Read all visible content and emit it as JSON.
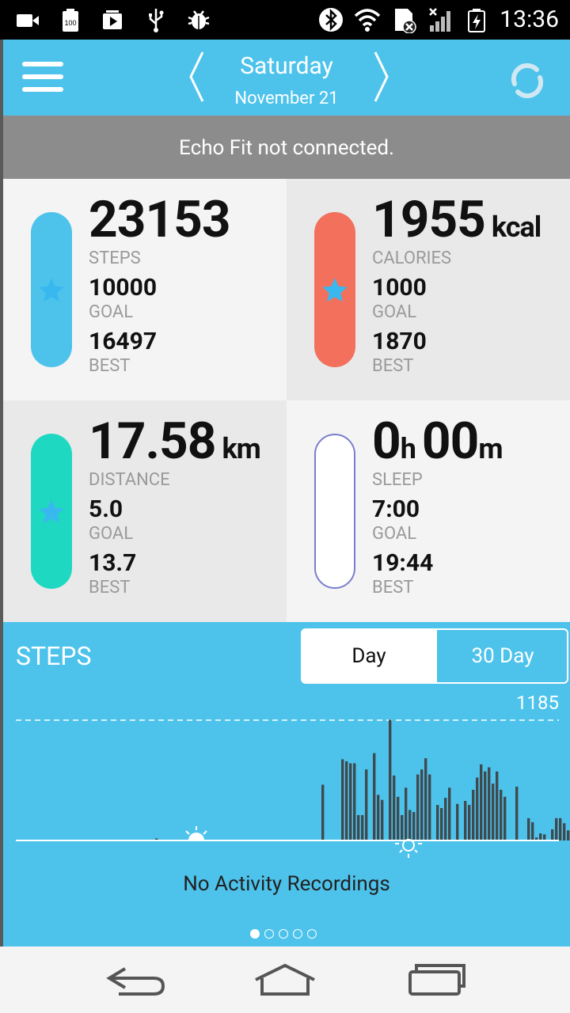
{
  "status_bar": {
    "time": "13:36",
    "battery_badge": "100",
    "left_icons": [
      "video-camera-icon",
      "battery-100-icon",
      "media-icon",
      "usb-icon",
      "bug-icon"
    ],
    "right_icons": [
      "bluetooth-icon",
      "wifi-icon",
      "sim-error-icon",
      "signal-icon",
      "battery-charging-icon"
    ]
  },
  "header": {
    "day": "Saturday",
    "date": "November 21"
  },
  "banner": {
    "text": "Echo Fit not connected."
  },
  "tiles": {
    "steps": {
      "value": "23153",
      "label": "STEPS",
      "goal": "10000",
      "goal_label": "GOAL",
      "best": "16497",
      "best_label": "BEST",
      "color": "#4dc3ec"
    },
    "calories": {
      "value": "1955",
      "unit": "kcal",
      "label": "CALORIES",
      "goal": "1000",
      "goal_label": "GOAL",
      "best": "1870",
      "best_label": "BEST",
      "color": "#f2705c"
    },
    "distance": {
      "value": "17.58",
      "unit": "km",
      "label": "DISTANCE",
      "goal": "5.0",
      "goal_label": "GOAL",
      "best": "13.7",
      "best_label": "BEST",
      "color": "#1ed8c2"
    },
    "sleep": {
      "hours": "0",
      "hours_unit": "h",
      "minutes": "00",
      "minutes_unit": "m",
      "label": "SLEEP",
      "goal": "7:00",
      "goal_label": "GOAL",
      "best": "19:44",
      "best_label": "BEST",
      "color": "#7a7ecb"
    }
  },
  "chart_section": {
    "title": "STEPS",
    "toggle_day": "Day",
    "toggle_30": "30 Day",
    "max_label": "1185",
    "empty_message": "No Activity Recordings",
    "page_count": 5,
    "active_page": 0
  },
  "chart_data": {
    "type": "bar",
    "ylim": [
      0,
      1185
    ],
    "values": [
      20,
      0,
      0,
      0,
      0,
      0,
      0,
      0,
      0,
      0,
      0,
      0,
      0,
      0,
      0,
      0,
      0,
      0,
      0,
      0,
      0,
      0,
      0,
      0,
      0,
      0,
      0,
      0,
      0,
      0,
      0,
      0,
      0,
      0,
      0,
      0,
      0,
      0,
      0,
      0,
      0,
      0,
      550,
      0,
      0,
      0,
      0,
      800,
      780,
      760,
      760,
      250,
      250,
      700,
      0,
      860,
      450,
      400,
      0,
      1190,
      640,
      430,
      250,
      520,
      300,
      280,
      650,
      700,
      810,
      650,
      0,
      350,
      320,
      420,
      520,
      0,
      360,
      0,
      390,
      350,
      500,
      620,
      750,
      680,
      720,
      560,
      680,
      500,
      430,
      0,
      0,
      530,
      0,
      0,
      220,
      180,
      30,
      70,
      60,
      0,
      110,
      220,
      220,
      170,
      100
    ]
  },
  "nav": {
    "icons": [
      "back-icon",
      "home-icon",
      "recent-apps-icon"
    ]
  }
}
